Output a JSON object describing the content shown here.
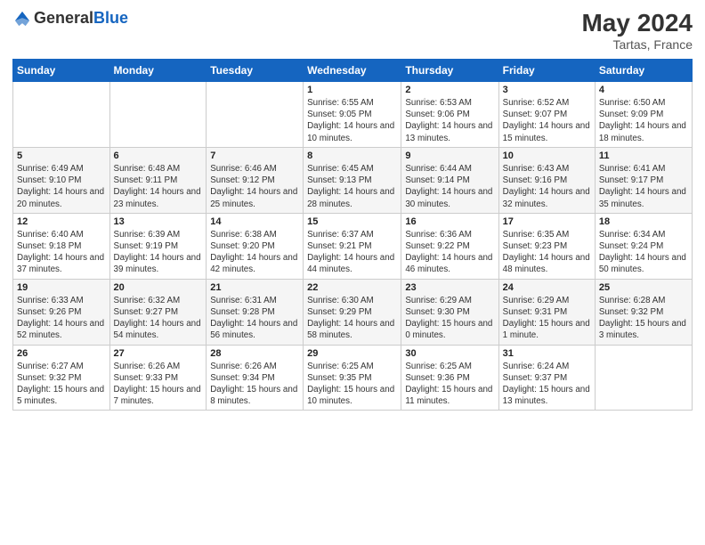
{
  "header": {
    "logo_general": "General",
    "logo_blue": "Blue",
    "month_year": "May 2024",
    "location": "Tartas, France"
  },
  "days_of_week": [
    "Sunday",
    "Monday",
    "Tuesday",
    "Wednesday",
    "Thursday",
    "Friday",
    "Saturday"
  ],
  "weeks": [
    [
      {
        "day": "",
        "sunrise": "",
        "sunset": "",
        "daylight": ""
      },
      {
        "day": "",
        "sunrise": "",
        "sunset": "",
        "daylight": ""
      },
      {
        "day": "",
        "sunrise": "",
        "sunset": "",
        "daylight": ""
      },
      {
        "day": "1",
        "sunrise": "Sunrise: 6:55 AM",
        "sunset": "Sunset: 9:05 PM",
        "daylight": "Daylight: 14 hours and 10 minutes."
      },
      {
        "day": "2",
        "sunrise": "Sunrise: 6:53 AM",
        "sunset": "Sunset: 9:06 PM",
        "daylight": "Daylight: 14 hours and 13 minutes."
      },
      {
        "day": "3",
        "sunrise": "Sunrise: 6:52 AM",
        "sunset": "Sunset: 9:07 PM",
        "daylight": "Daylight: 14 hours and 15 minutes."
      },
      {
        "day": "4",
        "sunrise": "Sunrise: 6:50 AM",
        "sunset": "Sunset: 9:09 PM",
        "daylight": "Daylight: 14 hours and 18 minutes."
      }
    ],
    [
      {
        "day": "5",
        "sunrise": "Sunrise: 6:49 AM",
        "sunset": "Sunset: 9:10 PM",
        "daylight": "Daylight: 14 hours and 20 minutes."
      },
      {
        "day": "6",
        "sunrise": "Sunrise: 6:48 AM",
        "sunset": "Sunset: 9:11 PM",
        "daylight": "Daylight: 14 hours and 23 minutes."
      },
      {
        "day": "7",
        "sunrise": "Sunrise: 6:46 AM",
        "sunset": "Sunset: 9:12 PM",
        "daylight": "Daylight: 14 hours and 25 minutes."
      },
      {
        "day": "8",
        "sunrise": "Sunrise: 6:45 AM",
        "sunset": "Sunset: 9:13 PM",
        "daylight": "Daylight: 14 hours and 28 minutes."
      },
      {
        "day": "9",
        "sunrise": "Sunrise: 6:44 AM",
        "sunset": "Sunset: 9:14 PM",
        "daylight": "Daylight: 14 hours and 30 minutes."
      },
      {
        "day": "10",
        "sunrise": "Sunrise: 6:43 AM",
        "sunset": "Sunset: 9:16 PM",
        "daylight": "Daylight: 14 hours and 32 minutes."
      },
      {
        "day": "11",
        "sunrise": "Sunrise: 6:41 AM",
        "sunset": "Sunset: 9:17 PM",
        "daylight": "Daylight: 14 hours and 35 minutes."
      }
    ],
    [
      {
        "day": "12",
        "sunrise": "Sunrise: 6:40 AM",
        "sunset": "Sunset: 9:18 PM",
        "daylight": "Daylight: 14 hours and 37 minutes."
      },
      {
        "day": "13",
        "sunrise": "Sunrise: 6:39 AM",
        "sunset": "Sunset: 9:19 PM",
        "daylight": "Daylight: 14 hours and 39 minutes."
      },
      {
        "day": "14",
        "sunrise": "Sunrise: 6:38 AM",
        "sunset": "Sunset: 9:20 PM",
        "daylight": "Daylight: 14 hours and 42 minutes."
      },
      {
        "day": "15",
        "sunrise": "Sunrise: 6:37 AM",
        "sunset": "Sunset: 9:21 PM",
        "daylight": "Daylight: 14 hours and 44 minutes."
      },
      {
        "day": "16",
        "sunrise": "Sunrise: 6:36 AM",
        "sunset": "Sunset: 9:22 PM",
        "daylight": "Daylight: 14 hours and 46 minutes."
      },
      {
        "day": "17",
        "sunrise": "Sunrise: 6:35 AM",
        "sunset": "Sunset: 9:23 PM",
        "daylight": "Daylight: 14 hours and 48 minutes."
      },
      {
        "day": "18",
        "sunrise": "Sunrise: 6:34 AM",
        "sunset": "Sunset: 9:24 PM",
        "daylight": "Daylight: 14 hours and 50 minutes."
      }
    ],
    [
      {
        "day": "19",
        "sunrise": "Sunrise: 6:33 AM",
        "sunset": "Sunset: 9:26 PM",
        "daylight": "Daylight: 14 hours and 52 minutes."
      },
      {
        "day": "20",
        "sunrise": "Sunrise: 6:32 AM",
        "sunset": "Sunset: 9:27 PM",
        "daylight": "Daylight: 14 hours and 54 minutes."
      },
      {
        "day": "21",
        "sunrise": "Sunrise: 6:31 AM",
        "sunset": "Sunset: 9:28 PM",
        "daylight": "Daylight: 14 hours and 56 minutes."
      },
      {
        "day": "22",
        "sunrise": "Sunrise: 6:30 AM",
        "sunset": "Sunset: 9:29 PM",
        "daylight": "Daylight: 14 hours and 58 minutes."
      },
      {
        "day": "23",
        "sunrise": "Sunrise: 6:29 AM",
        "sunset": "Sunset: 9:30 PM",
        "daylight": "Daylight: 15 hours and 0 minutes."
      },
      {
        "day": "24",
        "sunrise": "Sunrise: 6:29 AM",
        "sunset": "Sunset: 9:31 PM",
        "daylight": "Daylight: 15 hours and 1 minute."
      },
      {
        "day": "25",
        "sunrise": "Sunrise: 6:28 AM",
        "sunset": "Sunset: 9:32 PM",
        "daylight": "Daylight: 15 hours and 3 minutes."
      }
    ],
    [
      {
        "day": "26",
        "sunrise": "Sunrise: 6:27 AM",
        "sunset": "Sunset: 9:32 PM",
        "daylight": "Daylight: 15 hours and 5 minutes."
      },
      {
        "day": "27",
        "sunrise": "Sunrise: 6:26 AM",
        "sunset": "Sunset: 9:33 PM",
        "daylight": "Daylight: 15 hours and 7 minutes."
      },
      {
        "day": "28",
        "sunrise": "Sunrise: 6:26 AM",
        "sunset": "Sunset: 9:34 PM",
        "daylight": "Daylight: 15 hours and 8 minutes."
      },
      {
        "day": "29",
        "sunrise": "Sunrise: 6:25 AM",
        "sunset": "Sunset: 9:35 PM",
        "daylight": "Daylight: 15 hours and 10 minutes."
      },
      {
        "day": "30",
        "sunrise": "Sunrise: 6:25 AM",
        "sunset": "Sunset: 9:36 PM",
        "daylight": "Daylight: 15 hours and 11 minutes."
      },
      {
        "day": "31",
        "sunrise": "Sunrise: 6:24 AM",
        "sunset": "Sunset: 9:37 PM",
        "daylight": "Daylight: 15 hours and 13 minutes."
      },
      {
        "day": "",
        "sunrise": "",
        "sunset": "",
        "daylight": ""
      }
    ]
  ]
}
